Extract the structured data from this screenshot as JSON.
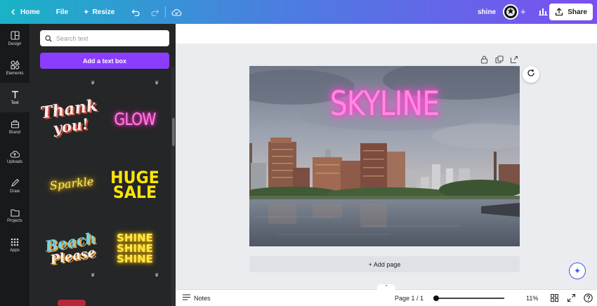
{
  "topbar": {
    "home_label": "Home",
    "file_label": "File",
    "resize_label": "Resize",
    "project_name": "shine",
    "share_label": "Share"
  },
  "rail": {
    "items": [
      {
        "label": "Design",
        "icon": "layout-icon"
      },
      {
        "label": "Elements",
        "icon": "shapes-icon"
      },
      {
        "label": "Text",
        "icon": "text-icon"
      },
      {
        "label": "Brand",
        "icon": "brand-icon"
      },
      {
        "label": "Uploads",
        "icon": "upload-icon"
      },
      {
        "label": "Draw",
        "icon": "pen-icon"
      },
      {
        "label": "Projects",
        "icon": "folder-icon"
      },
      {
        "label": "Apps",
        "icon": "apps-icon"
      }
    ]
  },
  "panel": {
    "search_placeholder": "Search text",
    "add_text_label": "Add a text box",
    "styles": [
      {
        "line1": "Thank",
        "line2": "you!"
      },
      {
        "line1": "GLOW"
      },
      {
        "line1": "Sparkle"
      },
      {
        "line1": "HUGE",
        "line2": "SALE"
      },
      {
        "line1": "Beach",
        "line2": "Please"
      },
      {
        "line1": "SHINE",
        "line2": "SHINE",
        "line3": "SHINE"
      }
    ]
  },
  "canvas": {
    "headline": "SKYLINE",
    "add_page_label": "+ Add page"
  },
  "bottombar": {
    "notes_label": "Notes",
    "page_label": "Page 1 / 1",
    "zoom_label": "11%",
    "zoom_fraction": 0.0
  },
  "colors": {
    "accent": "#8b3dff",
    "neon_pink": "#ff5fd2",
    "neon_yellow": "#ffe600"
  }
}
